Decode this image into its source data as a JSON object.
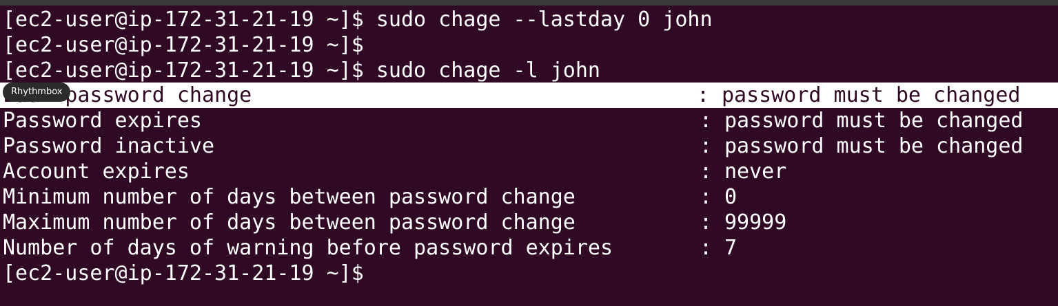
{
  "colors": {
    "background": "#300a24",
    "text": "#ffffff",
    "highlight": "#ffffff"
  },
  "terminal": {
    "prompt": "[ec2-user@ip-172-31-21-19 ~]$",
    "commands": [
      "sudo chage --lastday 0 john",
      "",
      "sudo chage -l john"
    ],
    "output": [
      {
        "label": "Last password change",
        "sep": ":",
        "value": "password must be changed"
      },
      {
        "label": "Password expires",
        "sep": ":",
        "value": "password must be changed"
      },
      {
        "label": "Password inactive",
        "sep": ":",
        "value": "password must be changed"
      },
      {
        "label": "Account expires",
        "sep": ":",
        "value": "never"
      },
      {
        "label": "Minimum number of days between password change",
        "sep": ":",
        "value": "0"
      },
      {
        "label": "Maximum number of days between password change",
        "sep": ":",
        "value": "99999"
      },
      {
        "label": "Number of days of warning before password expires",
        "sep": ":",
        "value": "7"
      }
    ],
    "final_prompt": "[ec2-user@ip-172-31-21-19 ~]$"
  },
  "tooltip": {
    "text": "Rhythmbox"
  }
}
